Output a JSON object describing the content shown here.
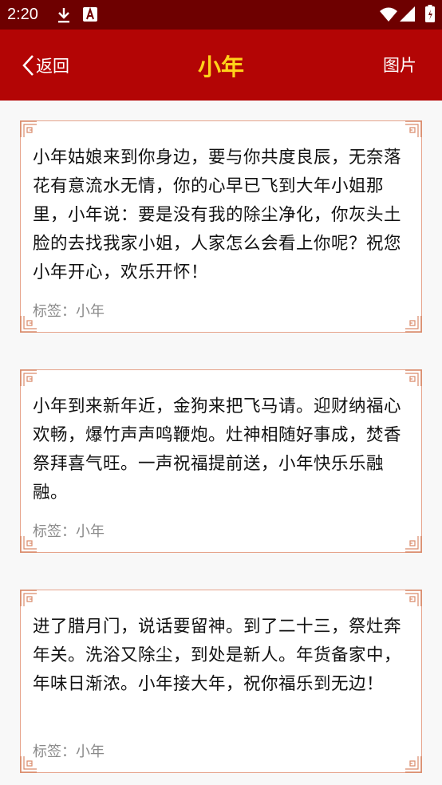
{
  "status_bar": {
    "time": "2:20",
    "icons": [
      "download-icon",
      "a-notification-icon",
      "wifi-icon",
      "cellular-icon",
      "battery-icon"
    ]
  },
  "header": {
    "back_label": "返回",
    "title": "小年",
    "image_button_label": "图片"
  },
  "colors": {
    "status_bar": "#6e0000",
    "app_bar": "#b30505",
    "title": "#ffd21a",
    "card_border": "#e6a48c",
    "tag_text": "#8a8a8a"
  },
  "cards": [
    {
      "text": "小年姑娘来到你身边，要与你共度良辰，无奈落花有意流水无情，你的心早已飞到大年小姐那里，小年说：要是没有我的除尘净化，你灰头土脸的去找我家小姐，人家怎么会看上你呢？祝您小年开心，欢乐开怀！",
      "tag": "标签：小年"
    },
    {
      "text": "小年到来新年近，金狗来把飞马请。迎财纳福心欢畅，爆竹声声鸣鞭炮。灶神相随好事成，焚香祭拜喜气旺。一声祝福提前送，小年快乐乐融融。",
      "tag": "标签：小年"
    },
    {
      "text": "进了腊月门，说话要留神。到了二十三，祭灶奔年关。洗浴又除尘，到处是新人。年货备家中，年味日渐浓。小年接大年，祝你福乐到无边！",
      "tag": "标签：小年"
    }
  ]
}
